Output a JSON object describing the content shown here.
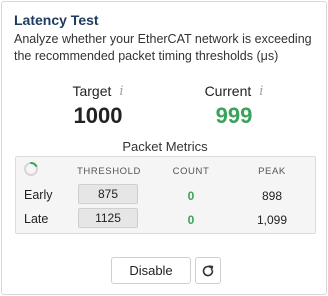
{
  "header": {
    "title": "Latency Test",
    "description": "Analyze whether your EtherCAT network is exceeding the recommended packet timing thresholds (μs)"
  },
  "stats": {
    "target": {
      "label": "Target",
      "value": "1000",
      "icon": "info-icon"
    },
    "current": {
      "label": "Current",
      "value": "999",
      "icon": "info-icon",
      "color": "#3aa35a"
    }
  },
  "metrics": {
    "label": "Packet Metrics",
    "columns": {
      "threshold": "THRESHOLD",
      "count": "COUNT",
      "peak": "PEAK"
    },
    "rows": [
      {
        "label": "Early",
        "threshold": "875",
        "count": "0",
        "peak": "898"
      },
      {
        "label": "Late",
        "threshold": "1125",
        "count": "0",
        "peak": "1,099"
      }
    ]
  },
  "actions": {
    "disable_label": "Disable",
    "refresh_icon": "refresh-icon"
  },
  "colors": {
    "title": "#1f3a5f",
    "success": "#3aa35a"
  }
}
